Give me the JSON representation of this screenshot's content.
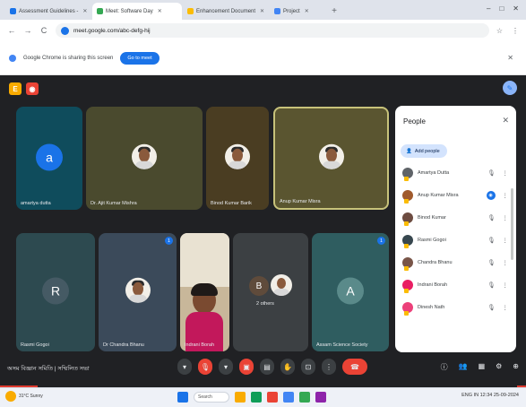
{
  "browser": {
    "tabs": [
      {
        "label": "Assessment Guidelines -",
        "color": "#1a73e8",
        "active": false
      },
      {
        "label": "Meet: Software Day",
        "color": "#34a853",
        "active": true
      },
      {
        "label": "Enhancement Document",
        "color": "#fbbc04",
        "active": false
      },
      {
        "label": "Project",
        "color": "#4285f4",
        "active": false
      }
    ],
    "new_tab": "+",
    "window_controls": [
      "–",
      "□",
      "✕"
    ],
    "url": "meet.google.com/abc-defg-hij",
    "nav": {
      "back": "←",
      "forward": "→",
      "reload": "C"
    },
    "right_icons": [
      "☆",
      "⋮"
    ]
  },
  "infobar": {
    "text": "Google Chrome is sharing this screen",
    "button": "Go to meet",
    "close": "✕"
  },
  "meet": {
    "ext_icons": [
      {
        "label": "E",
        "color": "#f9ab00"
      },
      {
        "label": "◉",
        "color": "#ea4335"
      }
    ],
    "top_right_icon": "✎",
    "tiles": [
      {
        "name": "amartya dutta",
        "type": "letter",
        "letter": "a",
        "avatar_color": "#1a73e8",
        "bg": "#0f4c5c"
      },
      {
        "name": "Dr. Ajit Kumar Mishra",
        "type": "photo",
        "bg": "#4a4a2e"
      },
      {
        "name": "Binod Kumar Barik",
        "type": "photo",
        "bg": "#4a3d22"
      },
      {
        "name": "Anup Kumar Misra",
        "type": "photo",
        "bg": "#5a5530",
        "highlight": true
      },
      {
        "name": "Rasmi Gogoi",
        "type": "letter",
        "letter": "R",
        "avatar_color": "#455a64",
        "bg": "#2d4a50"
      },
      {
        "name": "Dr Chandra Bhanu",
        "type": "photo",
        "bg": "#3b4a5a",
        "badge": "1"
      },
      {
        "name": "Indrani Borah",
        "type": "camera",
        "bg": "#c8b79a"
      },
      {
        "name": "B",
        "type": "letter_photo",
        "letter": "B",
        "sub": "2 others",
        "avatar_color": "#5f4b3b",
        "bg": "#3c4043"
      },
      {
        "name": "Assam Science Society",
        "type": "letter",
        "letter": "A",
        "avatar_color": "#5a8a8a",
        "bg": "#2f5d60",
        "badge": "1"
      }
    ],
    "people_panel": {
      "title": "People",
      "close": "✕",
      "add_button": "Add people",
      "add_icon": "person-add-icon",
      "participants": [
        {
          "name": "Amartya Dutta",
          "color": "#5f6368",
          "active": false
        },
        {
          "name": "Anup Kumar Misra",
          "color": "#a05a2c",
          "active": true
        },
        {
          "name": "Binod Kumar",
          "color": "#6d4c41",
          "active": false
        },
        {
          "name": "Rasmi Gogoi",
          "color": "#37474f",
          "active": false
        },
        {
          "name": "Chandra Bhanu",
          "color": "#795548",
          "active": false
        },
        {
          "name": "Indrani Borah",
          "color": "#e91e63",
          "active": false
        },
        {
          "name": "Dinesh Nath",
          "color": "#ec407a",
          "active": false
        }
      ],
      "mic_symbol": "🎙",
      "more_symbol": "⋮",
      "active_symbol": "◉"
    },
    "bottom_bar": {
      "meeting_name": "অসম বিজ্ঞান সমিতি | সম্মিলিত সভা",
      "controls": [
        {
          "name": "mic-button",
          "symbol": "▾",
          "red": false
        },
        {
          "name": "mic-off-button",
          "symbol": "🎙",
          "red": true
        },
        {
          "name": "camera-options-button",
          "symbol": "▾",
          "red": false
        },
        {
          "name": "camera-off-button",
          "symbol": "▣",
          "red": true
        },
        {
          "name": "captions-button",
          "symbol": "▤",
          "red": false
        },
        {
          "name": "raise-hand-button",
          "symbol": "✋",
          "red": false
        },
        {
          "name": "present-button",
          "symbol": "⊡",
          "red": false
        },
        {
          "name": "more-button",
          "symbol": "⋮",
          "red": false
        }
      ],
      "hangup": "☎",
      "right_controls": [
        "ⓘ",
        "👥",
        "▦",
        "⚙",
        "⊕"
      ]
    }
  },
  "taskbar": {
    "weather": "31°C Sunny",
    "search": "Search",
    "tray": "ENG  IN  12:34  25-09-2024"
  }
}
